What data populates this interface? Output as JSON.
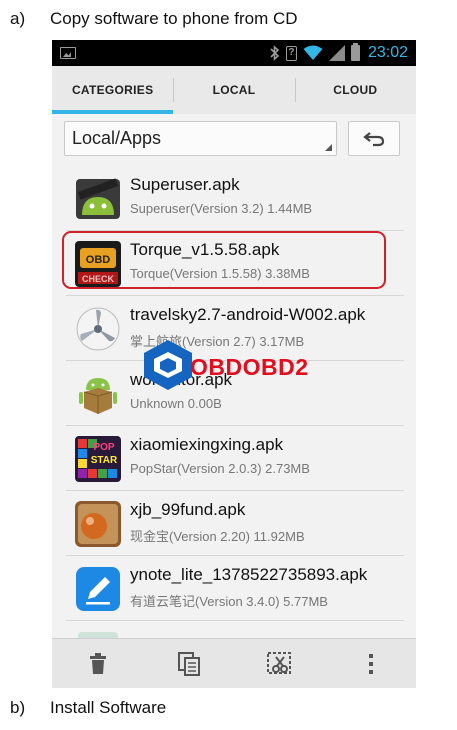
{
  "captions": {
    "a": {
      "tag": "a)",
      "text": "Copy software to phone from CD"
    },
    "b": {
      "tag": "b)",
      "text": "Install Software"
    }
  },
  "status_bar": {
    "time": "23:02",
    "icons": [
      "gallery-icon",
      "bluetooth-icon",
      "unknown-icon",
      "wifi-icon",
      "signal-icon",
      "battery-icon"
    ],
    "time_color": "#33b5e5"
  },
  "tabs": [
    {
      "label": "CATEGORIES",
      "active": true
    },
    {
      "label": "LOCAL",
      "active": false
    },
    {
      "label": "CLOUD",
      "active": false
    }
  ],
  "path_selector": {
    "value": "Local/Apps"
  },
  "files": [
    {
      "name": "Superuser.apk",
      "meta": "Superuser(Version 3.2) 1.44MB",
      "icon": "superuser-android-icon"
    },
    {
      "name": "Torque_v1.5.58.apk",
      "meta": "Torque(Version 1.5.58) 3.38MB",
      "icon": "torque-obd-check-icon",
      "highlighted": true
    },
    {
      "name": "travelsky2.7-android-W002.apk",
      "meta": "掌上航旅(Version 2.7) 3.17MB",
      "icon": "propeller-icon"
    },
    {
      "name": "wordtutor.apk",
      "meta": "Unknown 0.00B",
      "icon": "android-package-icon"
    },
    {
      "name": "xiaomiexingxing.apk",
      "meta": "PopStar(Version 2.0.3) 2.73MB",
      "icon": "popstar-icon"
    },
    {
      "name": "xjb_99fund.apk",
      "meta": "现金宝(Version 2.20) 11.92MB",
      "icon": "xjb-ball-icon"
    },
    {
      "name": "ynote_lite_1378522735893.apk",
      "meta": "有道云笔记(Version 3.4.0) 5.77MB",
      "icon": "ynote-pen-icon"
    },
    {
      "name": "",
      "meta": "",
      "icon": "partial-app-icon"
    }
  ],
  "watermark": {
    "text": "OBDOBD2"
  },
  "bottom_actions": [
    {
      "icon": "delete-icon"
    },
    {
      "icon": "copy-icon"
    },
    {
      "icon": "cut-icon"
    },
    {
      "icon": "overflow-menu-icon"
    }
  ],
  "colors": {
    "accent": "#33b5e5",
    "highlight": "#d0202a",
    "watermark": "#e10e1e"
  }
}
